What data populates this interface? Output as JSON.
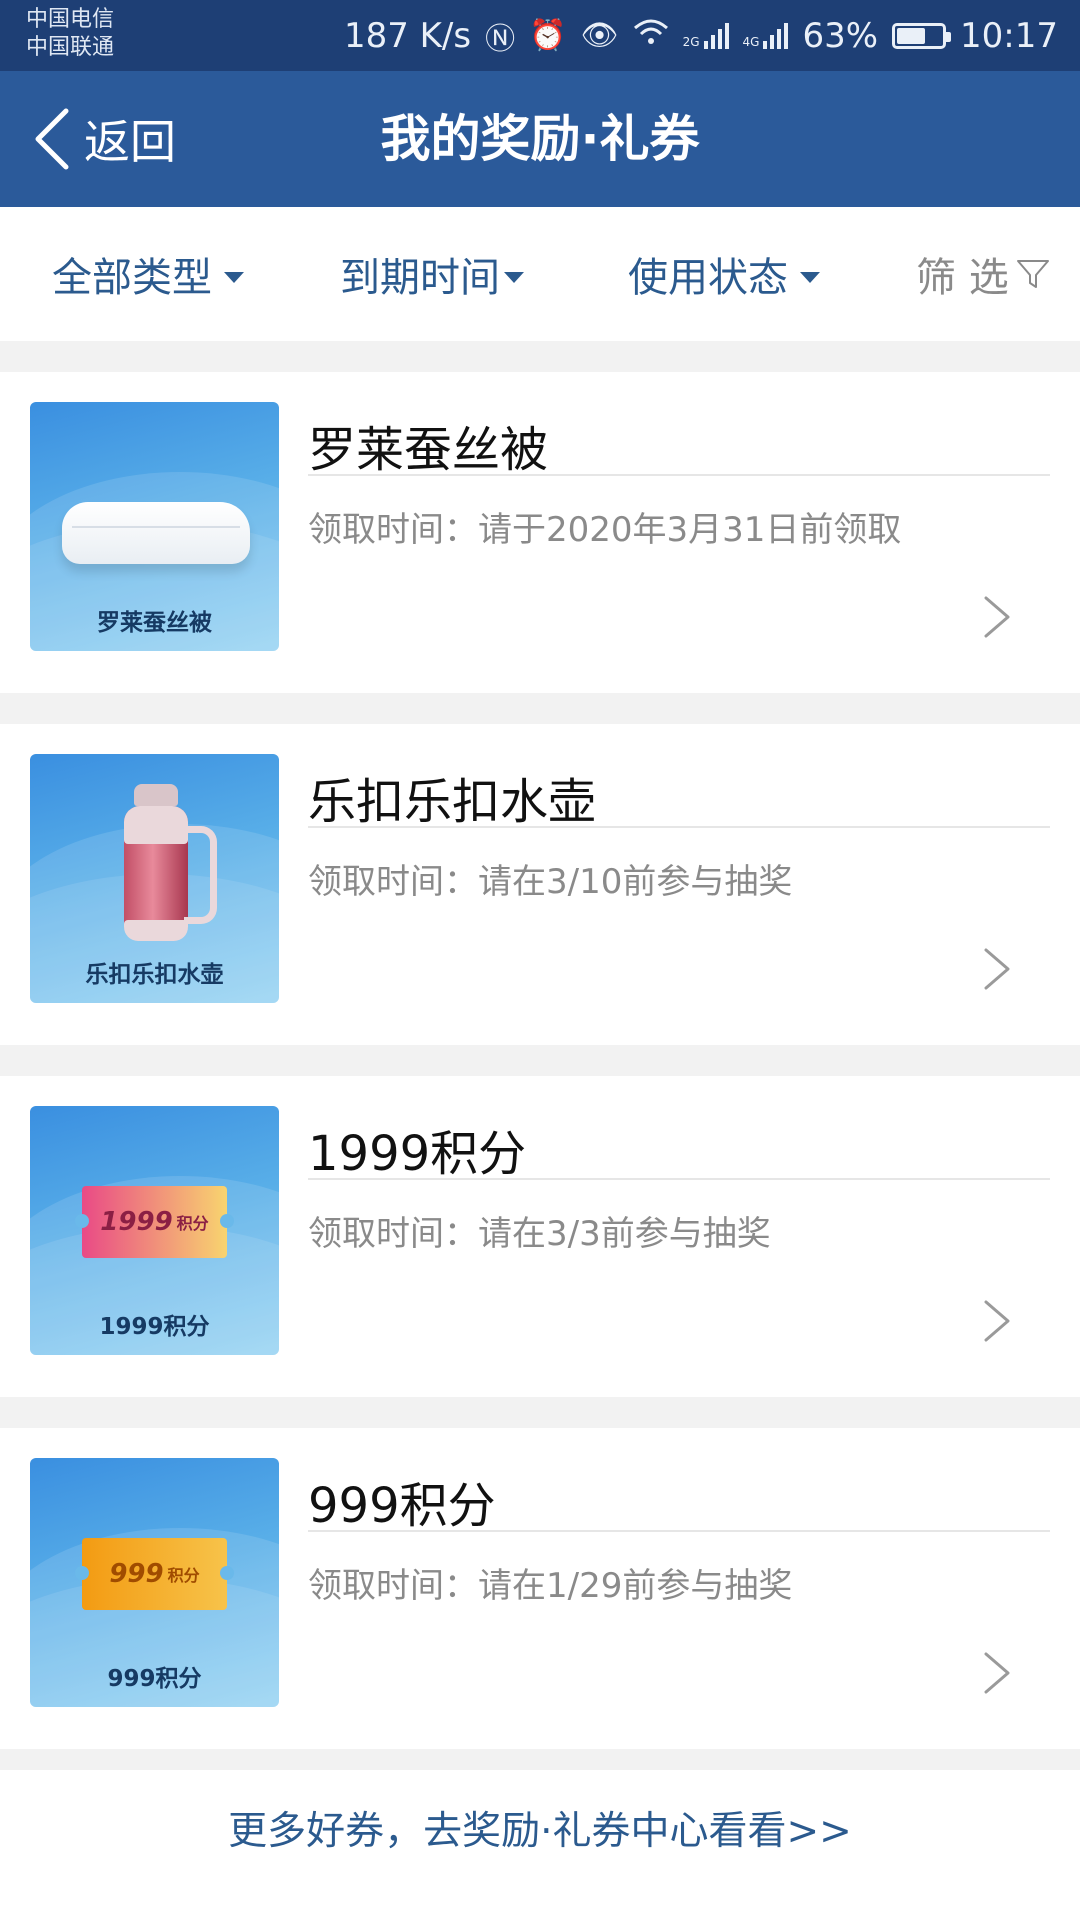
{
  "status_bar": {
    "carrier_1": "中国电信",
    "carrier_2": "中国联通",
    "net_speed": "187 K/s",
    "battery": "63%",
    "battery_level": 0.63,
    "time": "10:17",
    "signal_1_label": "2G",
    "signal_2_label": "4G"
  },
  "header": {
    "back_label": "返回",
    "title": "我的奖励·礼券"
  },
  "filters": {
    "type": "全部类型",
    "expiry": "到期时间",
    "status": "使用状态",
    "screen": "筛 选"
  },
  "items": [
    {
      "title": "罗莱蚕丝被",
      "thumb_caption": "罗莱蚕丝被",
      "claim_time": "领取时间：请于2020年3月31日前领取",
      "image": "quilt"
    },
    {
      "title": "乐扣乐扣水壶",
      "thumb_caption": "乐扣乐扣水壶",
      "claim_time": "领取时间：请在3/10前参与抽奖",
      "image": "thermos-bottle"
    },
    {
      "title": "1999积分",
      "thumb_caption": "1999积分",
      "claim_time": "领取时间：请在3/3前参与抽奖",
      "image": "points-ticket",
      "ticket_value": "1999",
      "ticket_unit": "积分"
    },
    {
      "title": "999积分",
      "thumb_caption": "999积分",
      "claim_time": "领取时间：请在1/29前参与抽奖",
      "image": "points-ticket",
      "ticket_value": "999",
      "ticket_unit": "积分"
    }
  ],
  "footer": {
    "more_link": "更多好券，去奖励·礼券中心看看>>"
  },
  "colors": {
    "status_bar": "#1e3f75",
    "nav_bar": "#2b5a9a",
    "accent_text": "#2b5a8e",
    "muted_text": "#8a8a8a"
  }
}
